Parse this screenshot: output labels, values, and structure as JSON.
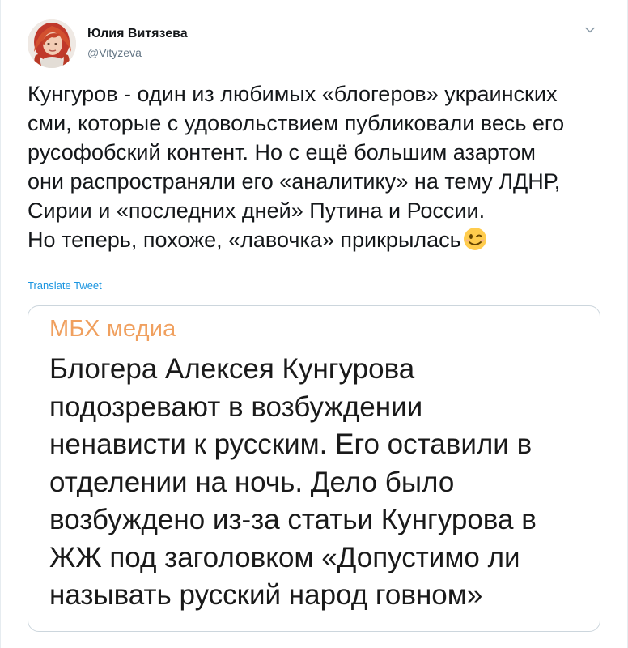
{
  "author": {
    "name": "Юлия Витязева",
    "handle": "@Vityzeva"
  },
  "tweet": {
    "lines": [
      "Кунгуров - один из любимых «блогеров» украинских",
      "сми, которые с удовольствием публиковали весь его",
      "русофобский контент. Но с ещё большим азартом",
      "они распространяли его «аналитику» на тему ЛДНР,",
      "Сирии и «последних дней» Путина и России.",
      "Но теперь, похоже, «лавочка» прикрылась"
    ],
    "translate_label": "Translate Tweet"
  },
  "media_card": {
    "source": "МБХ медиа",
    "lines": [
      "Блогера Алексея Кунгурова",
      "подозревают в возбуждении",
      "ненависти к русским. Его оставили в",
      "отделении на ночь. Дело было",
      "возбуждено из-за статьи Кунгурова в",
      "ЖЖ под заголовком «Допустимо ли",
      "называть русский народ говном»"
    ]
  },
  "icons": {
    "menu": "chevron-down-icon",
    "emoji": "winking-face-emoji"
  },
  "colors": {
    "link": "#1b95e0",
    "source_orange": "#f0a05f",
    "muted": "#657786",
    "border": "#ccd6dd"
  }
}
